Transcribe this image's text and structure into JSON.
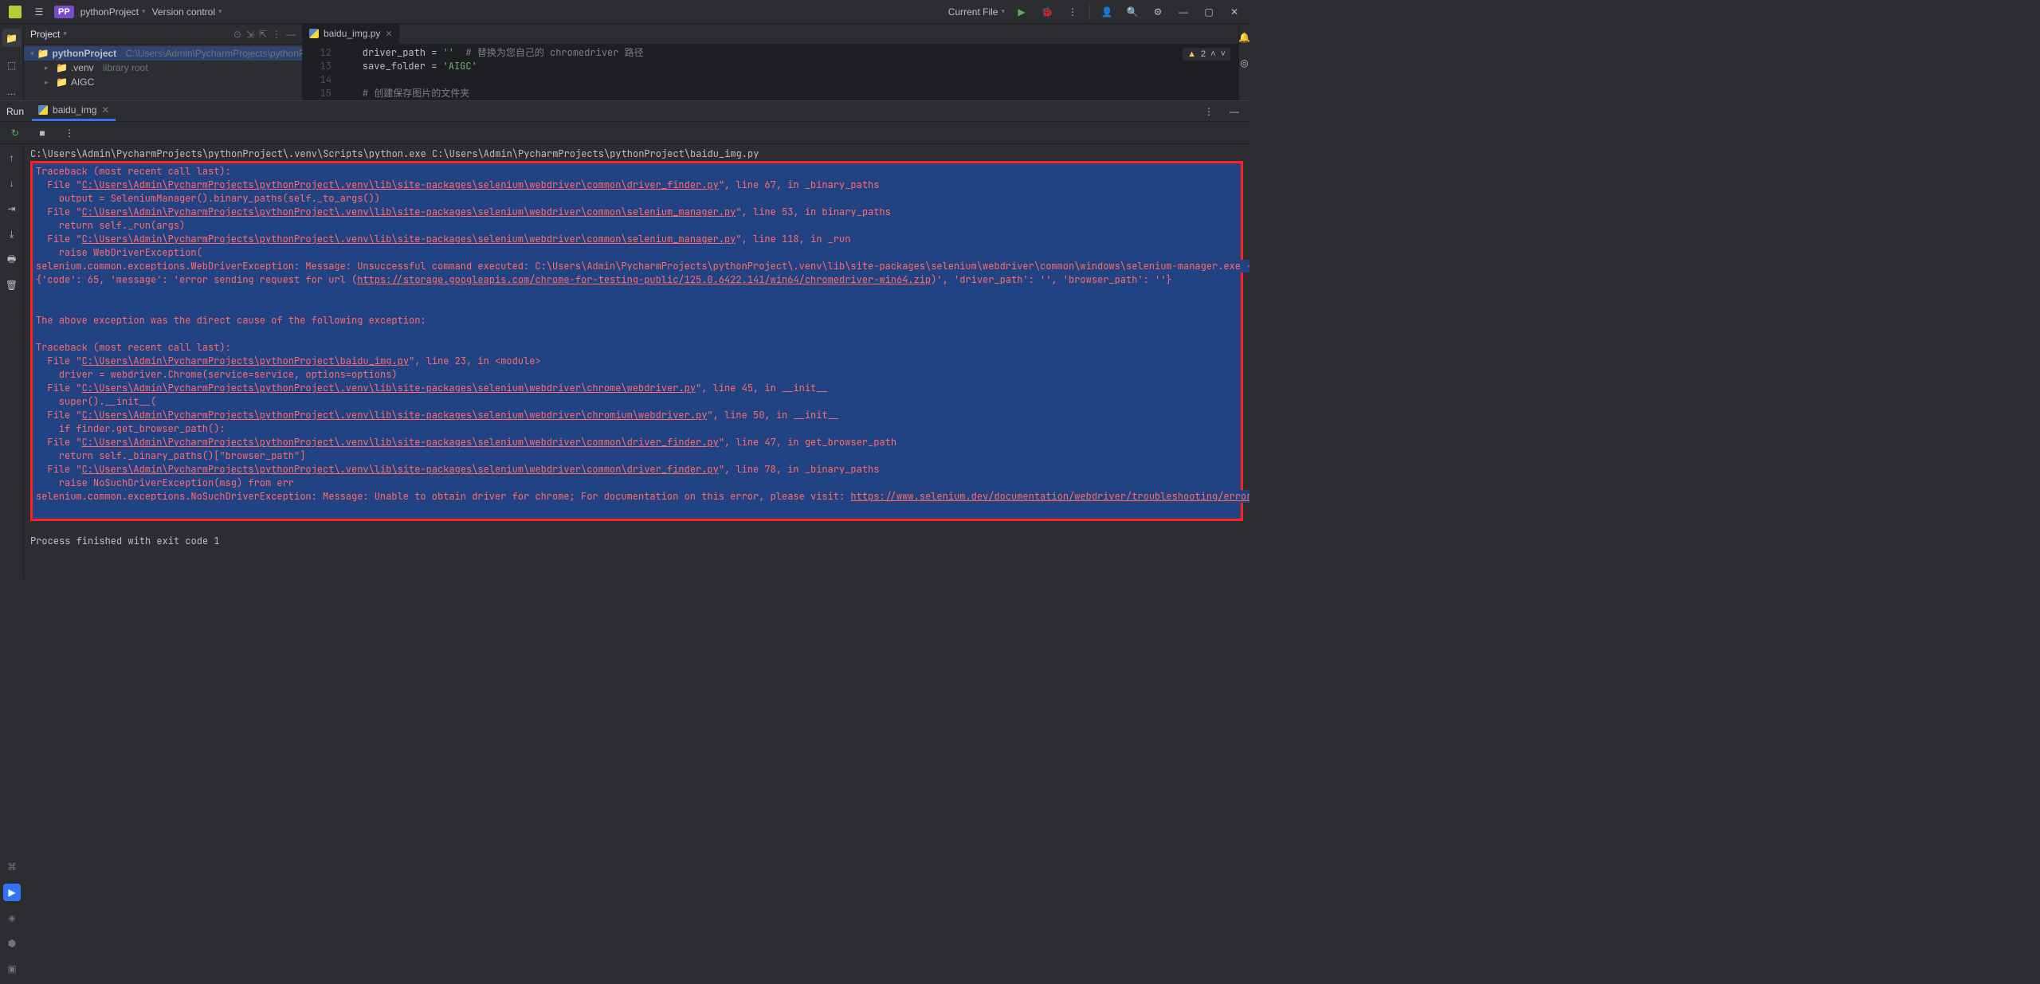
{
  "titlebar": {
    "project_badge": "PP",
    "project_name": "pythonProject",
    "version_control": "Version control",
    "current_file": "Current File"
  },
  "project_pane": {
    "title": "Project",
    "root": "pythonProject",
    "root_path": "C:\\Users\\Admin\\PycharmProjects\\pythonProject",
    "items": [
      {
        "name": ".venv",
        "suffix": "library root"
      },
      {
        "name": "AIGC",
        "suffix": ""
      }
    ]
  },
  "editor": {
    "tab_label": "baidu_img.py",
    "warnings_count": "2",
    "lines": [
      {
        "n": "12",
        "pre": "    driver_path = ",
        "str": "''",
        "post": "  ",
        "comment": "# 替换为您自己的 chromedriver 路径"
      },
      {
        "n": "13",
        "pre": "    save_folder = ",
        "str": "'AIGC'",
        "post": "",
        "comment": ""
      },
      {
        "n": "14",
        "pre": "",
        "str": "",
        "post": "",
        "comment": ""
      },
      {
        "n": "15",
        "pre": "    ",
        "str": "",
        "post": "",
        "comment": "# 创建保存图片的文件夹"
      }
    ]
  },
  "run": {
    "panel_label": "Run",
    "tab_label": "baidu_img",
    "cmd": "C:\\Users\\Admin\\PycharmProjects\\pythonProject\\.venv\\Scripts\\python.exe C:\\Users\\Admin\\PycharmProjects\\pythonProject\\baidu_img.py ",
    "exit": "Process finished with exit code 1",
    "paths": {
      "driver_finder": "C:\\Users\\Admin\\PycharmProjects\\pythonProject\\.venv\\lib\\site-packages\\selenium\\webdriver\\common\\driver_finder.py",
      "selenium_manager": "C:\\Users\\Admin\\PycharmProjects\\pythonProject\\.venv\\lib\\site-packages\\selenium\\webdriver\\common\\selenium_manager.py",
      "baidu_img": "C:\\Users\\Admin\\PycharmProjects\\pythonProject\\baidu_img.py",
      "chrome_wd": "C:\\Users\\Admin\\PycharmProjects\\pythonProject\\.venv\\lib\\site-packages\\selenium\\webdriver\\chrome\\webdriver.py",
      "chromium_wd": "C:\\Users\\Admin\\PycharmProjects\\pythonProject\\.venv\\lib\\site-packages\\selenium\\webdriver\\chromium\\webdriver.py"
    },
    "urls": {
      "chromedriver_zip": "https://storage.googleapis.com/chrome-for-testing-public/125.0.6422.141/win64/chromedriver-win64.zip",
      "selenium_docs": "https://www.selenium.dev/documentation/webdriver/troubleshooting/errors/driver_location"
    },
    "tb": {
      "header": "Traceback (most recent call last):",
      "l1_suffix": "\", line 67, in _binary_paths",
      "l1_code": "    output = SeleniumManager().binary_paths(self._to_args())",
      "l2_suffix": "\", line 53, in binary_paths",
      "l2_code": "    return self._run(args)",
      "l3_suffix": "\", line 118, in _run",
      "l3_code": "    raise WebDriverException(",
      "wde_msg_pre": "selenium.common.exceptions.WebDriverException: Message: Unsuccessful command executed: C:\\Users\\Admin\\PycharmProjects\\pythonProject\\.venv\\lib\\site-packages\\selenium\\webdriver\\common\\windows\\selenium-manager.exe --browser chrome --language-b",
      "wde_dict_pre": "{'code': 65, 'message': 'error sending request for url (",
      "wde_dict_post": ")', 'driver_path': '', 'browser_path': ''}",
      "chain": "The above exception was the direct cause of the following exception:",
      "m1_suffix": "\", line 23, in <module>",
      "m1_code": "    driver = webdriver.Chrome(service=service, options=options)",
      "m2_suffix": "\", line 45, in __init__",
      "m2_code": "    super().__init__(",
      "m3_suffix": "\", line 50, in __init__",
      "m3_code": "    if finder.get_browser_path():",
      "m4_suffix": "\", line 47, in get_browser_path",
      "m4_code": "    return self._binary_paths()[\"browser_path\"]",
      "m5_suffix": "\", line 78, in _binary_paths",
      "m5_code": "    raise NoSuchDriverException(msg) from err",
      "nsd_pre": "selenium.common.exceptions.NoSuchDriverException: Message: Unable to obtain driver for chrome; For documentation on this error, please visit: ",
      "file_prefix": "  File \""
    }
  }
}
